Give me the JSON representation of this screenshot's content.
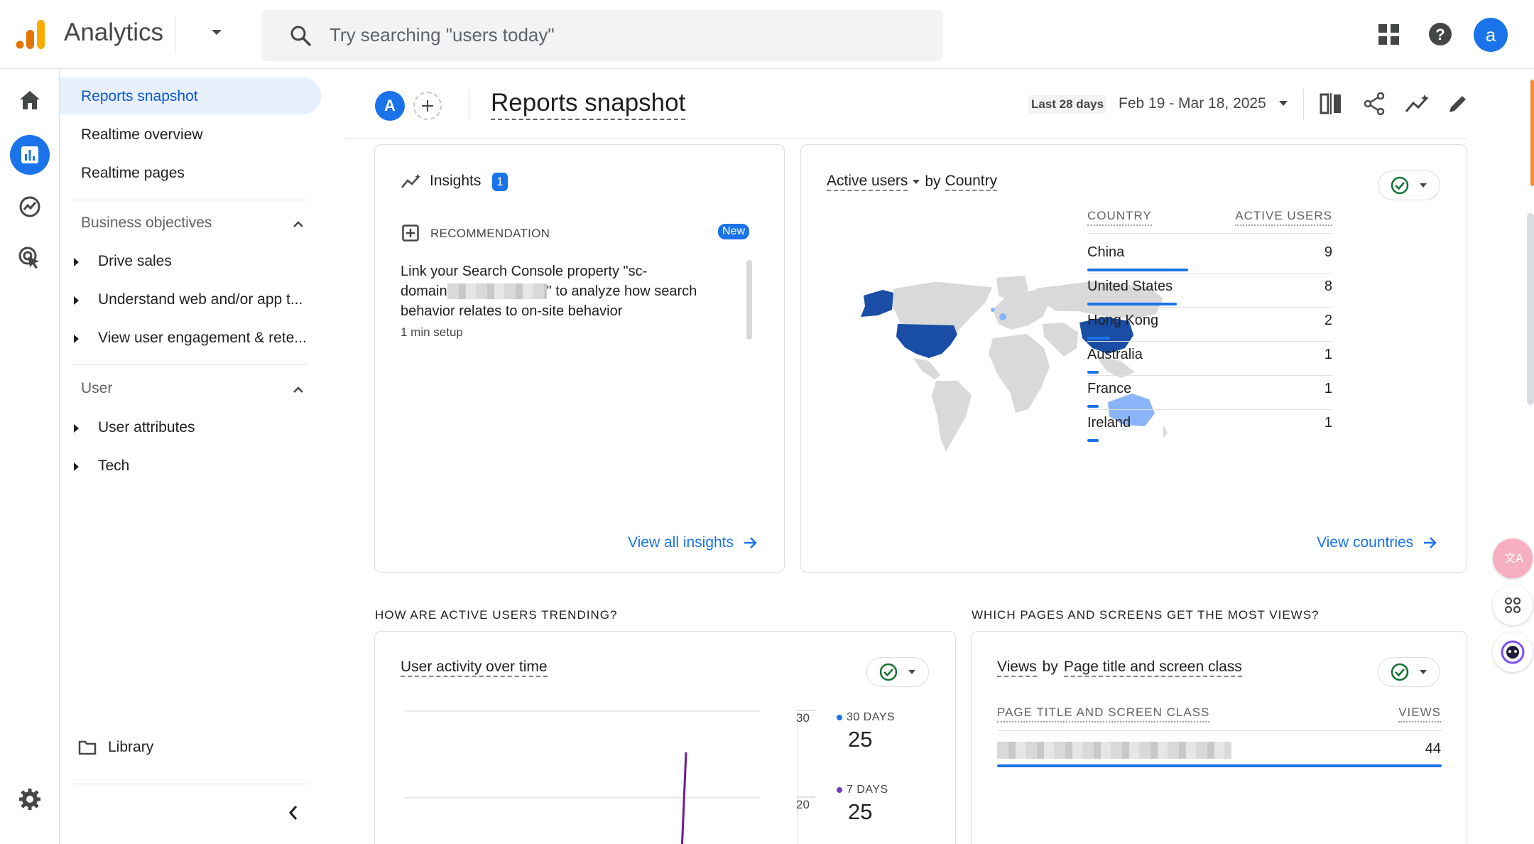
{
  "app": {
    "name": "Analytics",
    "search_placeholder": "Try searching \"users today\"",
    "account_initial": "a"
  },
  "nav": {
    "items": [
      {
        "label": "Reports snapshot",
        "active": true
      },
      {
        "label": "Realtime overview"
      },
      {
        "label": "Realtime pages"
      }
    ],
    "sections": [
      {
        "label": "Business objectives",
        "children": [
          "Drive sales",
          "Understand web and/or app t...",
          "View user engagement & rete..."
        ]
      },
      {
        "label": "User",
        "children": [
          "User attributes",
          "Tech"
        ]
      }
    ],
    "library_label": "Library"
  },
  "header": {
    "comparison_initial": "A",
    "title": "Reports snapshot",
    "date_badge": "Last 28 days",
    "date_range": "Feb 19 - Mar 18, 2025"
  },
  "insights": {
    "title": "Insights",
    "count": "1",
    "rec_label": "RECOMMENDATION",
    "new_badge": "New",
    "rec_text_1": "Link your Search Console property \"sc-",
    "rec_text_2a": "domain",
    "rec_text_2b": "\" to analyze how search",
    "rec_text_3": "behavior relates to on-site behavior",
    "rec_setup": "1 min setup",
    "view_all": "View all insights"
  },
  "countries": {
    "metric": "Active users",
    "by": "by",
    "dimension": "Country",
    "col_country": "COUNTRY",
    "col_users": "ACTIVE USERS",
    "rows": [
      {
        "name": "China",
        "value": "9",
        "share": 1.0
      },
      {
        "name": "United States",
        "value": "8",
        "share": 0.889
      },
      {
        "name": "Hong Kong",
        "value": "2",
        "share": 0.222
      },
      {
        "name": "Australia",
        "value": "1",
        "share": 0.111
      },
      {
        "name": "France",
        "value": "1",
        "share": 0.111
      },
      {
        "name": "Ireland",
        "value": "1",
        "share": 0.111
      }
    ],
    "view_link": "View countries",
    "map_colors": {
      "high": "#1a4ea6",
      "low": "#8ab4f8",
      "none": "#d9d9d9"
    }
  },
  "trending": {
    "heading": "HOW ARE ACTIVE USERS TRENDING?",
    "card_title": "User activity over time",
    "y_ticks": [
      "30",
      "20"
    ],
    "legend": [
      {
        "label": "30 DAYS",
        "value": "25",
        "color": "#1a73e8"
      },
      {
        "label": "7 DAYS",
        "value": "25",
        "color": "#6e3cc7"
      }
    ]
  },
  "pages": {
    "heading": "WHICH PAGES AND SCREENS GET THE MOST VIEWS?",
    "title_metric": "Views",
    "title_by": "by",
    "title_dim": "Page title and screen class",
    "col_page": "PAGE TITLE AND SCREEN CLASS",
    "col_views": "VIEWS",
    "row_value": "44"
  }
}
